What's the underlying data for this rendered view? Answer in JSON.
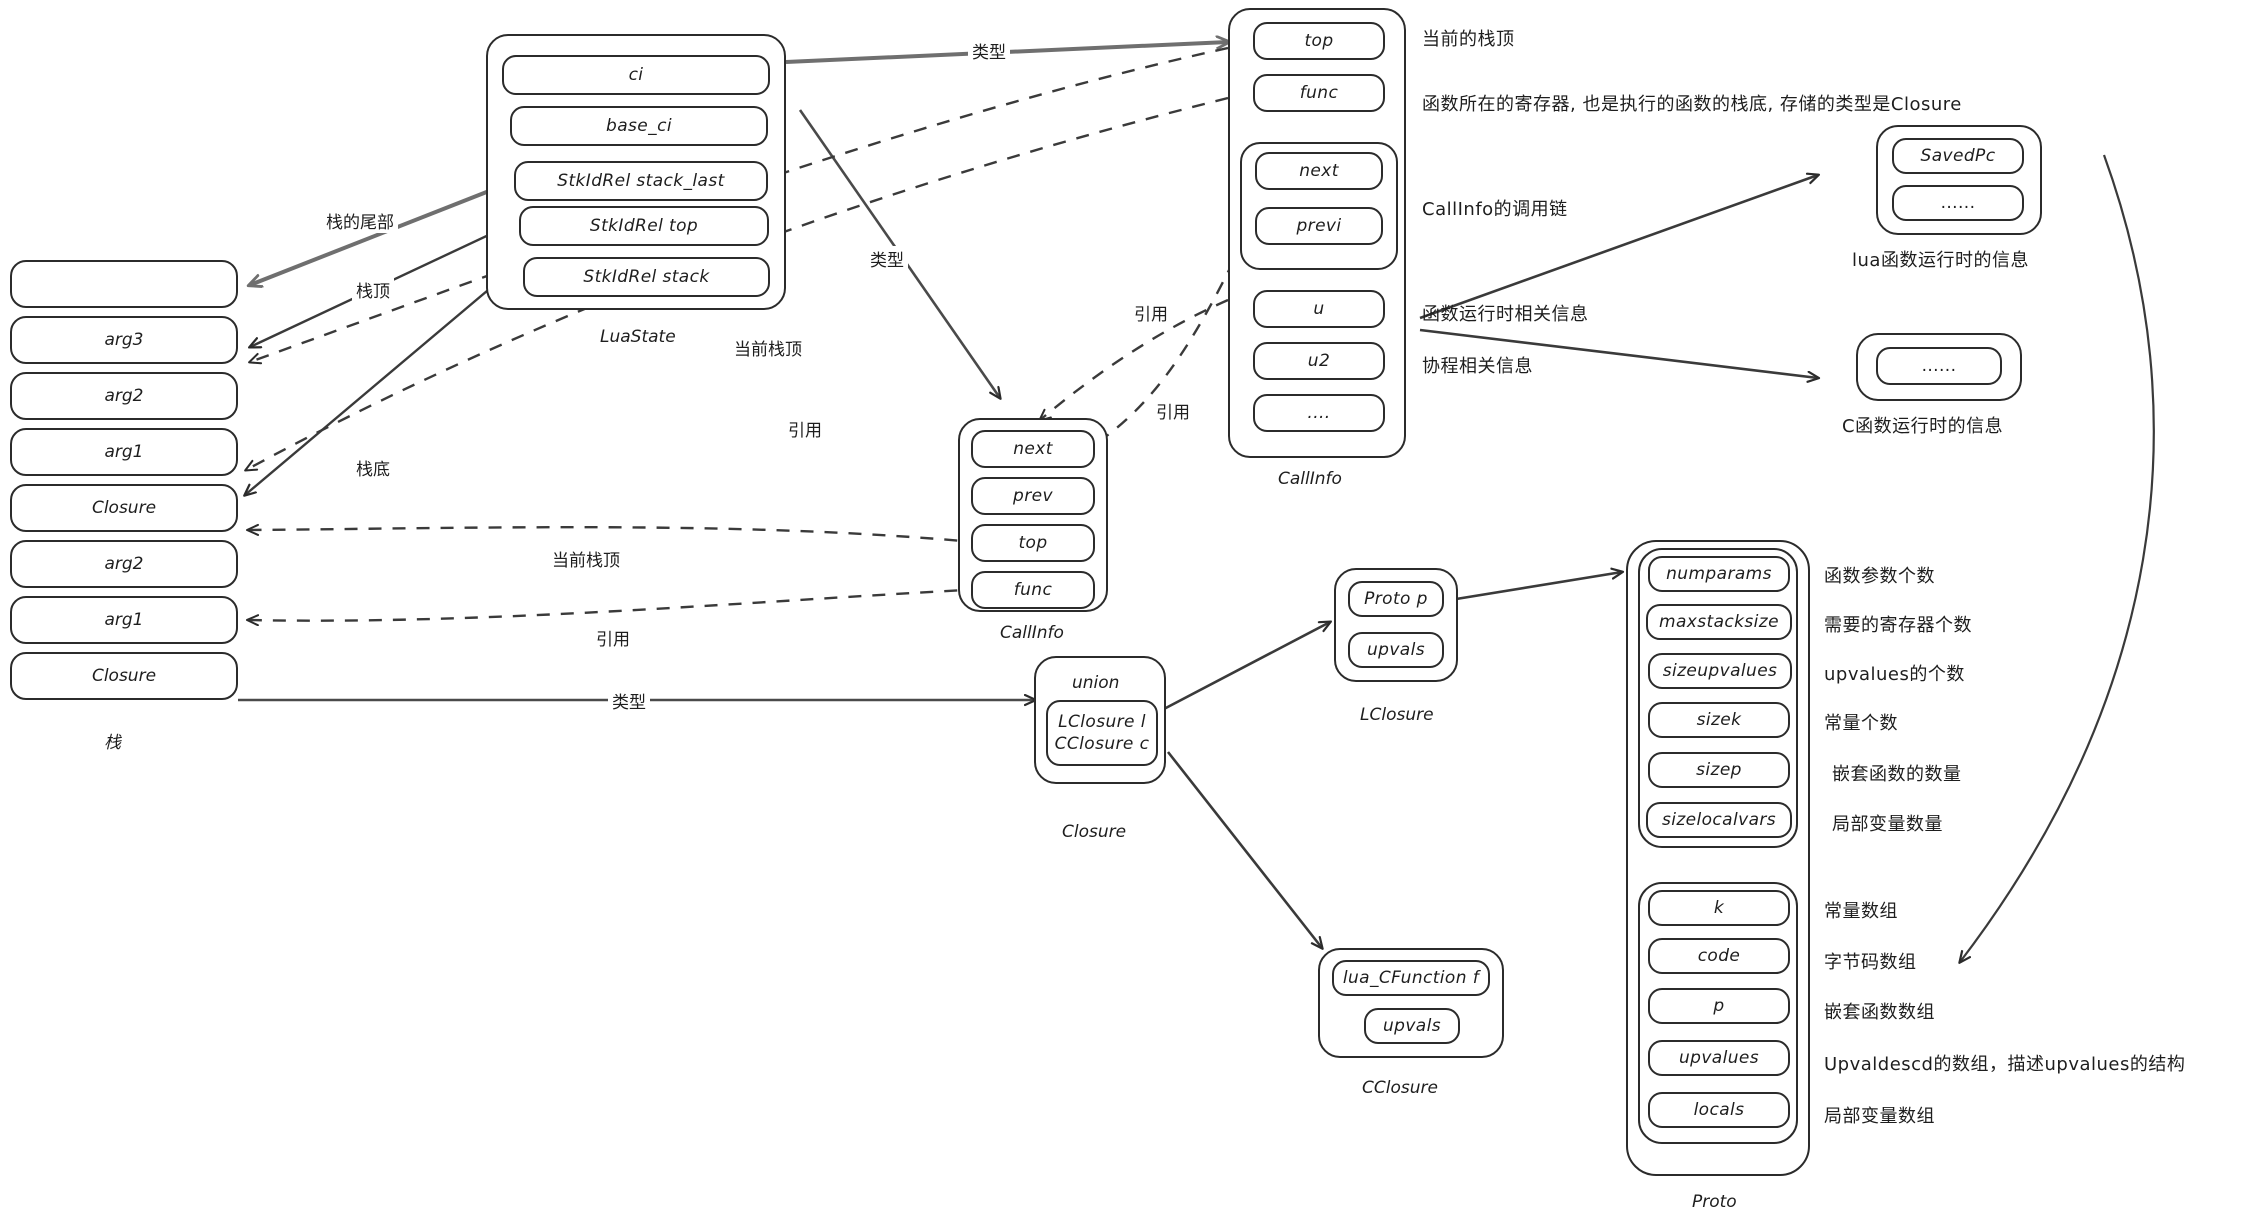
{
  "diagram": {
    "title": "Lua VM data structures",
    "stroke_color": "#2b2b2b",
    "gray_stroke_color": "#6f6f6f",
    "background": "#ffffff"
  },
  "stack": {
    "caption": "栈",
    "cells": [
      "",
      "arg3",
      "arg2",
      "arg1",
      "Closure",
      "arg2",
      "arg1",
      "Closure"
    ]
  },
  "luastate": {
    "caption": "LuaState",
    "fields": [
      "ci",
      "base_ci",
      "StkIdRel stack_last",
      "StkIdRel top",
      "StkIdRel stack"
    ]
  },
  "callinfo_top": {
    "caption": "CallInfo",
    "fields": [
      "top",
      "func",
      "next",
      "previ",
      "u",
      "u2",
      "...."
    ],
    "annotations": [
      "当前的栈顶",
      "函数所在的寄存器, 也是执行的函数的栈底, 存储的类型是Closure",
      "CallInfo的调用链",
      "函数运行时相关信息",
      "协程相关信息"
    ]
  },
  "callinfo_mid": {
    "caption": "CallInfo",
    "fields": [
      "next",
      "prev",
      "top",
      "func"
    ]
  },
  "lua_runtime": {
    "caption": "lua函数运行时的信息",
    "fields": [
      "SavedPc",
      "......"
    ]
  },
  "c_runtime": {
    "caption": "C函数运行时的信息",
    "fields": [
      "......"
    ]
  },
  "closure": {
    "caption": "Closure",
    "union_label": "union",
    "fields": [
      "LClosure l",
      "CClosure c"
    ]
  },
  "lclosure": {
    "caption": "LClosure",
    "fields": [
      "Proto p",
      "upvals"
    ]
  },
  "cclosure": {
    "caption": "CClosure",
    "fields": [
      "lua_CFunction f",
      "upvals"
    ]
  },
  "proto": {
    "caption": "Proto",
    "group_a": [
      "numparams",
      "maxstacksize",
      "sizeupvalues",
      "sizek",
      "sizep",
      "sizelocalvars"
    ],
    "group_b": [
      "k",
      "code",
      "p",
      "upvalues",
      "locals"
    ],
    "annotations_a": [
      "函数参数个数",
      "需要的寄存器个数",
      "upvalues的个数",
      "常量个数",
      "嵌套函数的数量",
      "局部变量数量"
    ],
    "annotations_b": [
      "常量数组",
      "字节码数组",
      "嵌套函数数组",
      "Upvaldescd的数组，描述upvalues的结构",
      "局部变量数组"
    ]
  },
  "edge_labels": {
    "stack_tail": "栈的尾部",
    "stack_top": "栈顶",
    "stack_bottom": "栈底",
    "type_1": "类型",
    "type_2": "类型",
    "type_3": "类型",
    "current_top_1": "当前栈顶",
    "current_top_2": "当前栈顶",
    "ref_1": "引用",
    "ref_2": "引用",
    "ref_3": "引用",
    "ref_4": "引用"
  }
}
